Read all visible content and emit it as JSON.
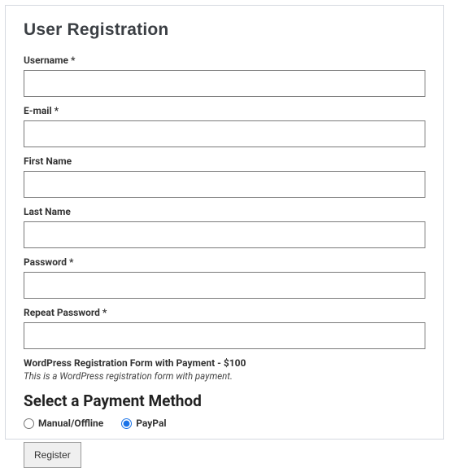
{
  "title": "User Registration",
  "fields": {
    "username_label": "Username *",
    "username_value": "",
    "email_label": "E-mail *",
    "email_value": "",
    "first_name_label": "First Name",
    "first_name_value": "",
    "last_name_label": "Last Name",
    "last_name_value": "",
    "password_label": "Password *",
    "password_value": "",
    "repeat_password_label": "Repeat Password *",
    "repeat_password_value": ""
  },
  "payment": {
    "product_line": "WordPress Registration Form with Payment - $100",
    "description": "This is a WordPress registration form with payment.",
    "heading": "Select a Payment Method",
    "options": {
      "manual_label": "Manual/Offline",
      "paypal_label": "PayPal"
    },
    "selected": "paypal"
  },
  "submit_label": "Register"
}
